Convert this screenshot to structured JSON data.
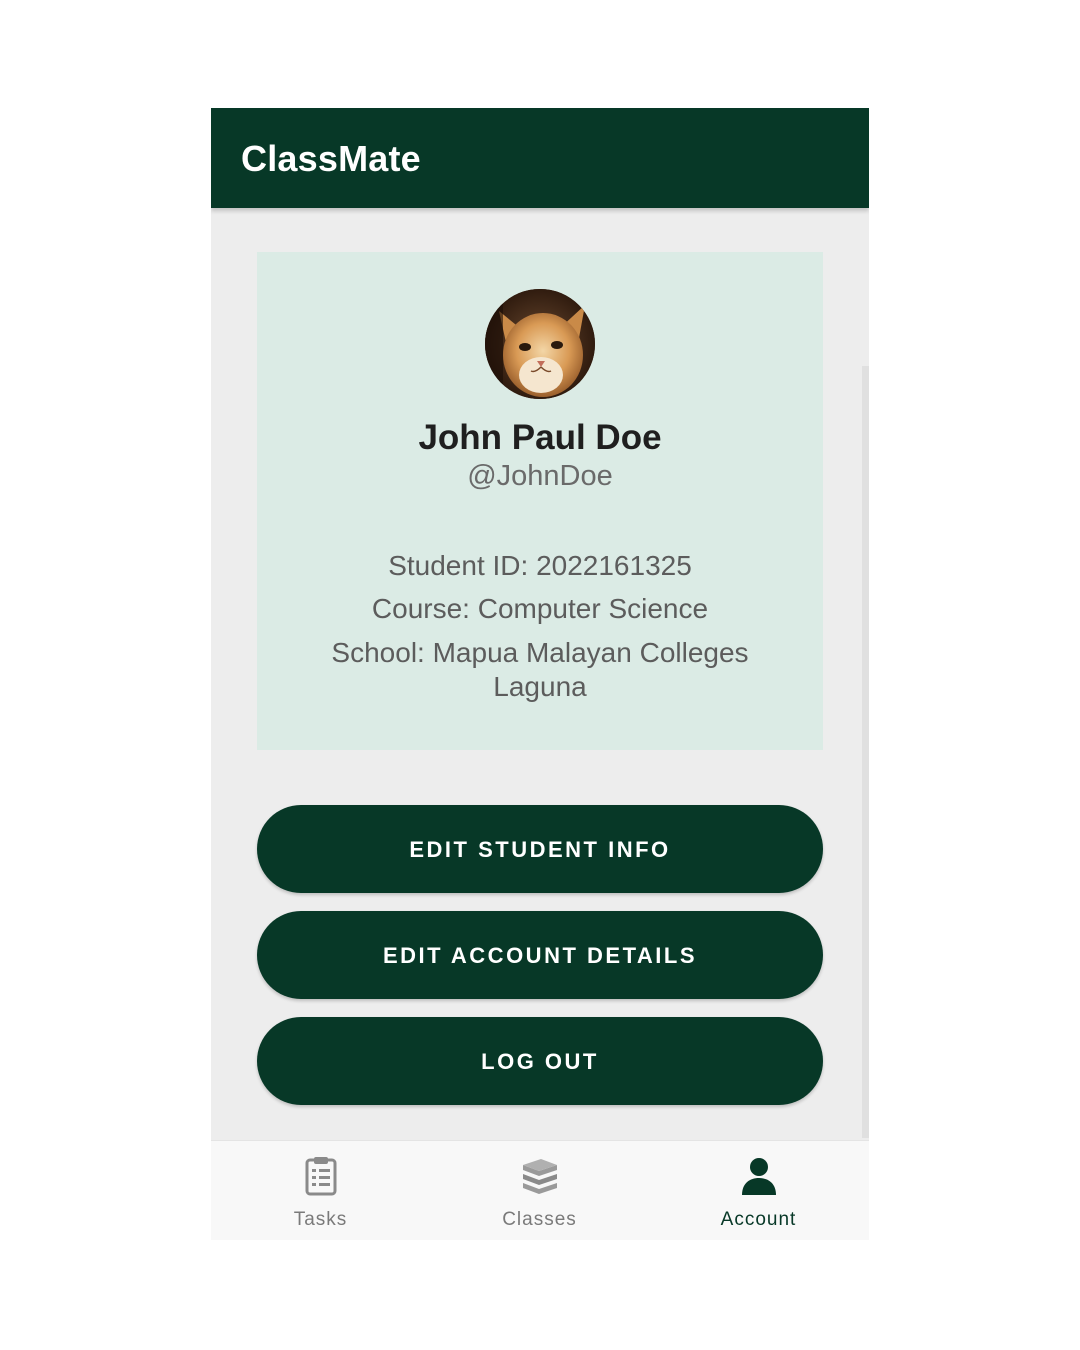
{
  "app": {
    "title": "ClassMate"
  },
  "profile": {
    "avatar_icon": "cat-avatar-photo",
    "full_name": "John Paul Doe",
    "username": "@JohnDoe",
    "student_id": "Student ID: 2022161325",
    "course": "Course: Computer Science",
    "school": "School: Mapua Malayan Colleges Laguna"
  },
  "actions": {
    "edit_student_info": "EDIT STUDENT INFO",
    "edit_account_details": "EDIT ACCOUNT DETAILS",
    "log_out": "LOG OUT"
  },
  "bottom_nav": {
    "items": [
      {
        "label": "Tasks",
        "icon": "clipboard-icon",
        "active": false
      },
      {
        "label": "Classes",
        "icon": "books-stack-icon",
        "active": false
      },
      {
        "label": "Account",
        "icon": "person-icon",
        "active": true
      }
    ]
  },
  "colors": {
    "brand_dark_green": "#073827",
    "card_background": "#dbebe5",
    "screen_background": "#ededed",
    "inactive_nav": "#7a7a7a"
  }
}
